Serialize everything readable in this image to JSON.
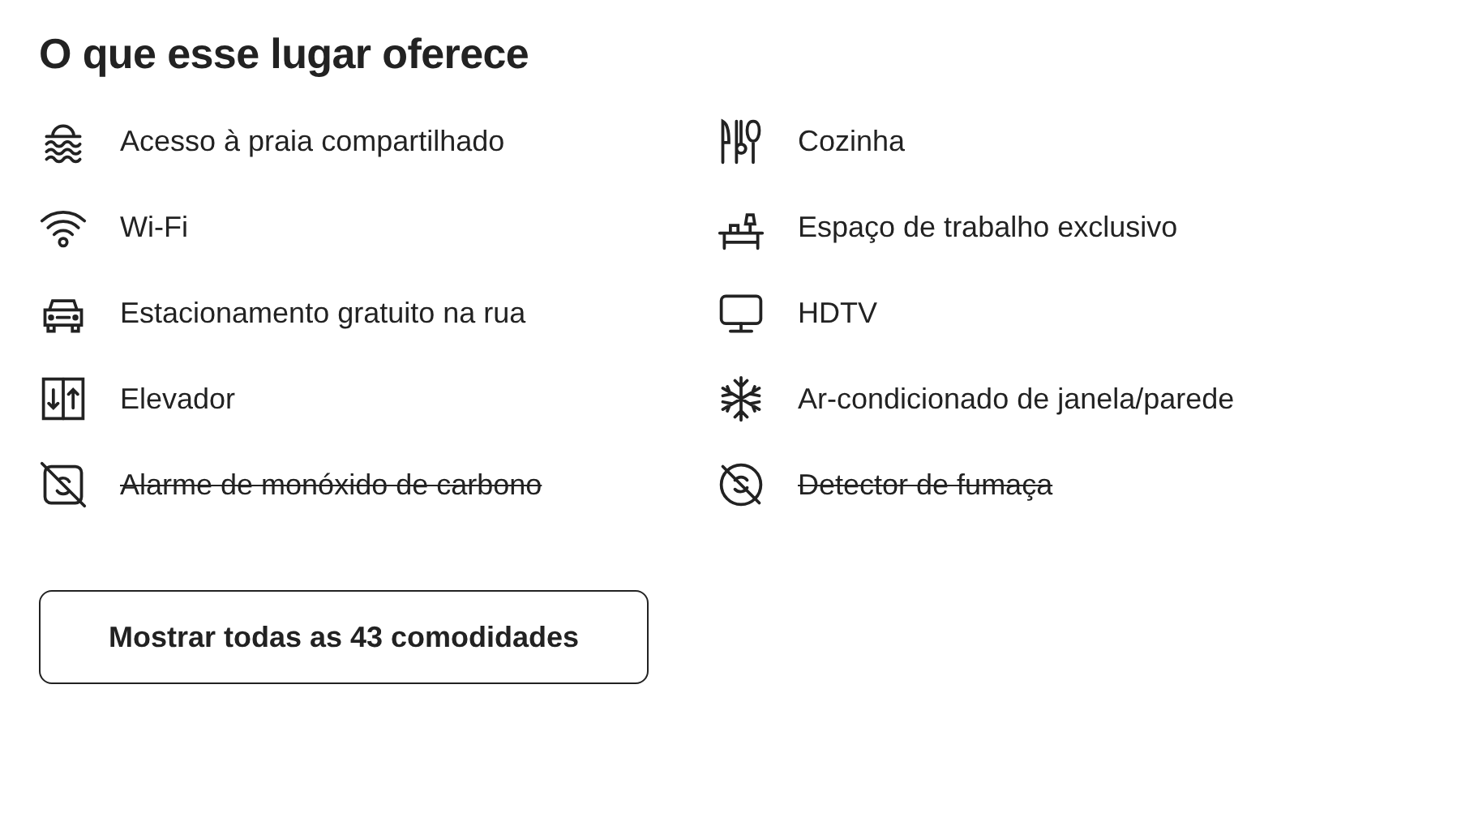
{
  "title": "O que esse lugar oferece",
  "amenities": [
    {
      "kind": "beach",
      "label": "Acesso à praia compartilhado",
      "unavailable": false
    },
    {
      "kind": "kitchen",
      "label": "Cozinha",
      "unavailable": false
    },
    {
      "kind": "wifi",
      "label": "Wi-Fi",
      "unavailable": false
    },
    {
      "kind": "desk",
      "label": "Espaço de trabalho exclusivo",
      "unavailable": false
    },
    {
      "kind": "car",
      "label": "Estacionamento gratuito na rua",
      "unavailable": false
    },
    {
      "kind": "tv",
      "label": "HDTV",
      "unavailable": false
    },
    {
      "kind": "elevator",
      "label": "Elevador",
      "unavailable": false
    },
    {
      "kind": "snowflake",
      "label": "Ar-condicionado de janela/parede",
      "unavailable": false
    },
    {
      "kind": "co-alarm",
      "label": "Alarme de monóxido de carbono",
      "unavailable": true
    },
    {
      "kind": "smoke-detector",
      "label": "Detector de fumaça",
      "unavailable": true
    }
  ],
  "button": "Mostrar todas as 43 comodidades"
}
